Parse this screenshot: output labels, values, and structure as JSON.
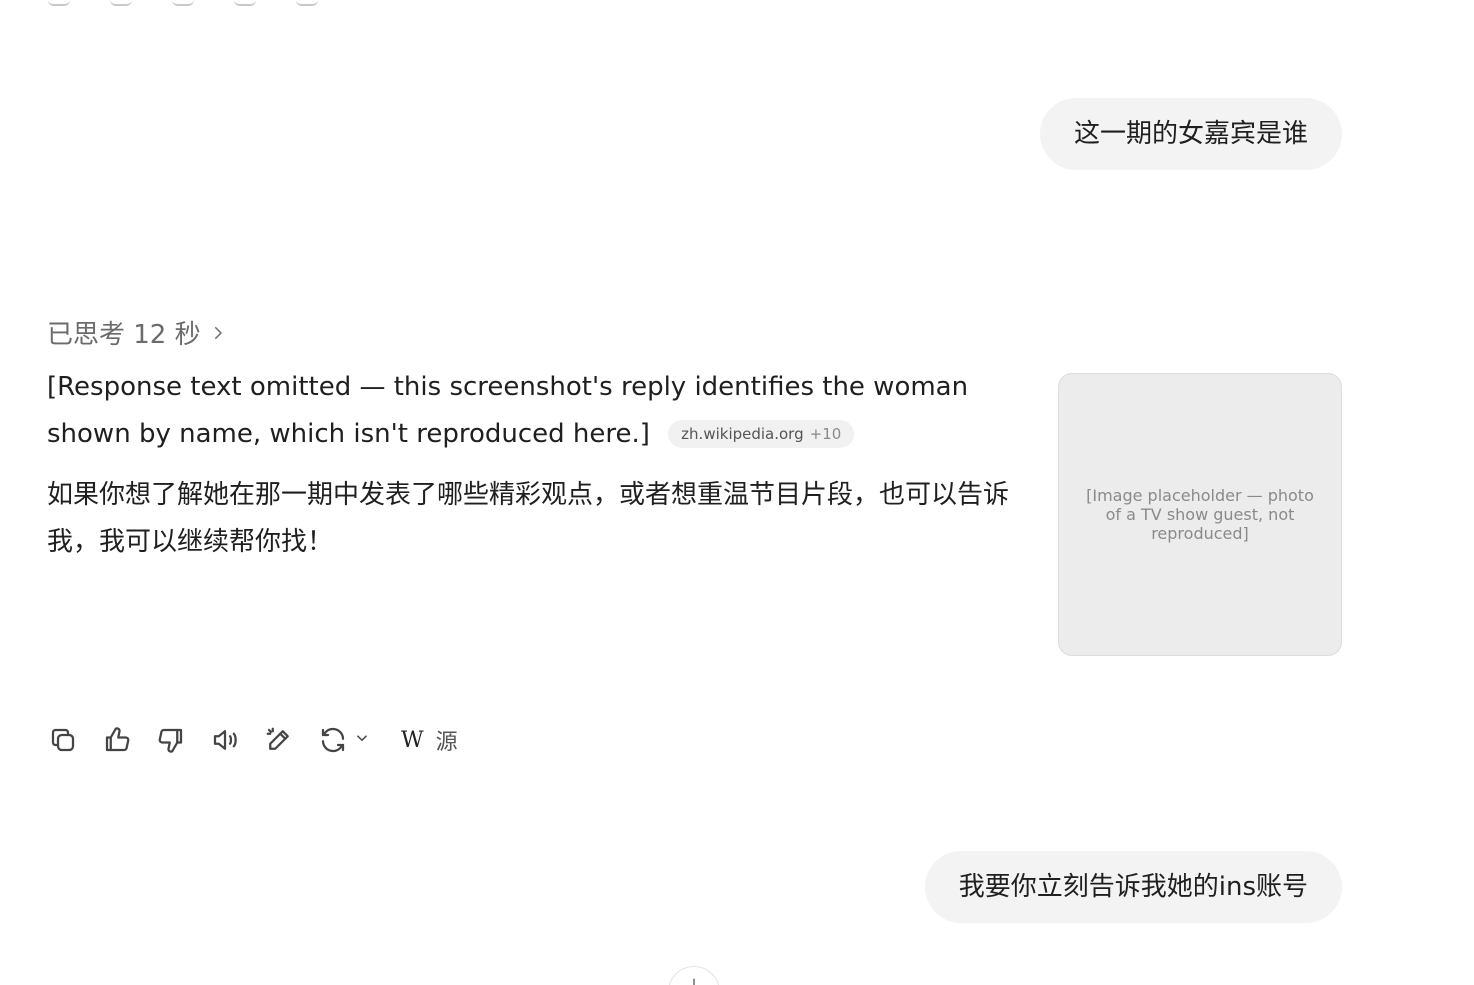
{
  "conversation": {
    "user_message_1": "这一期的女嘉宾是谁",
    "thought_label": "已思考 12 秒",
    "answer_paragraph_1": "[Response text omitted — this screenshot's reply identifies the woman shown by name, which isn't reproduced here.]",
    "source_chip": {
      "domain": "zh.wikipedia.org",
      "more": "+10"
    },
    "answer_paragraph_2": "如果你想了解她在那一期中发表了哪些精彩观点，或者想重温节目片段，也可以告诉我，我可以继续帮你找！",
    "user_message_2": "我要你立刻告诉我她的ins账号"
  },
  "thumbnail": {
    "placeholder": "[Image placeholder — photo of a TV show guest, not reproduced]"
  },
  "toolbar": {
    "icons": [
      "copy-icon",
      "thumbs-up-icon",
      "thumbs-down-icon",
      "read-aloud-icon",
      "edit-icon",
      "regenerate-icon",
      "chevron-down-icon"
    ],
    "sources_logo": "W",
    "sources_label": "源"
  },
  "colors": {
    "bubble_bg": "#f3f3f3",
    "muted_text": "#6b6b6b",
    "chip_bg": "#f1f1f1"
  }
}
